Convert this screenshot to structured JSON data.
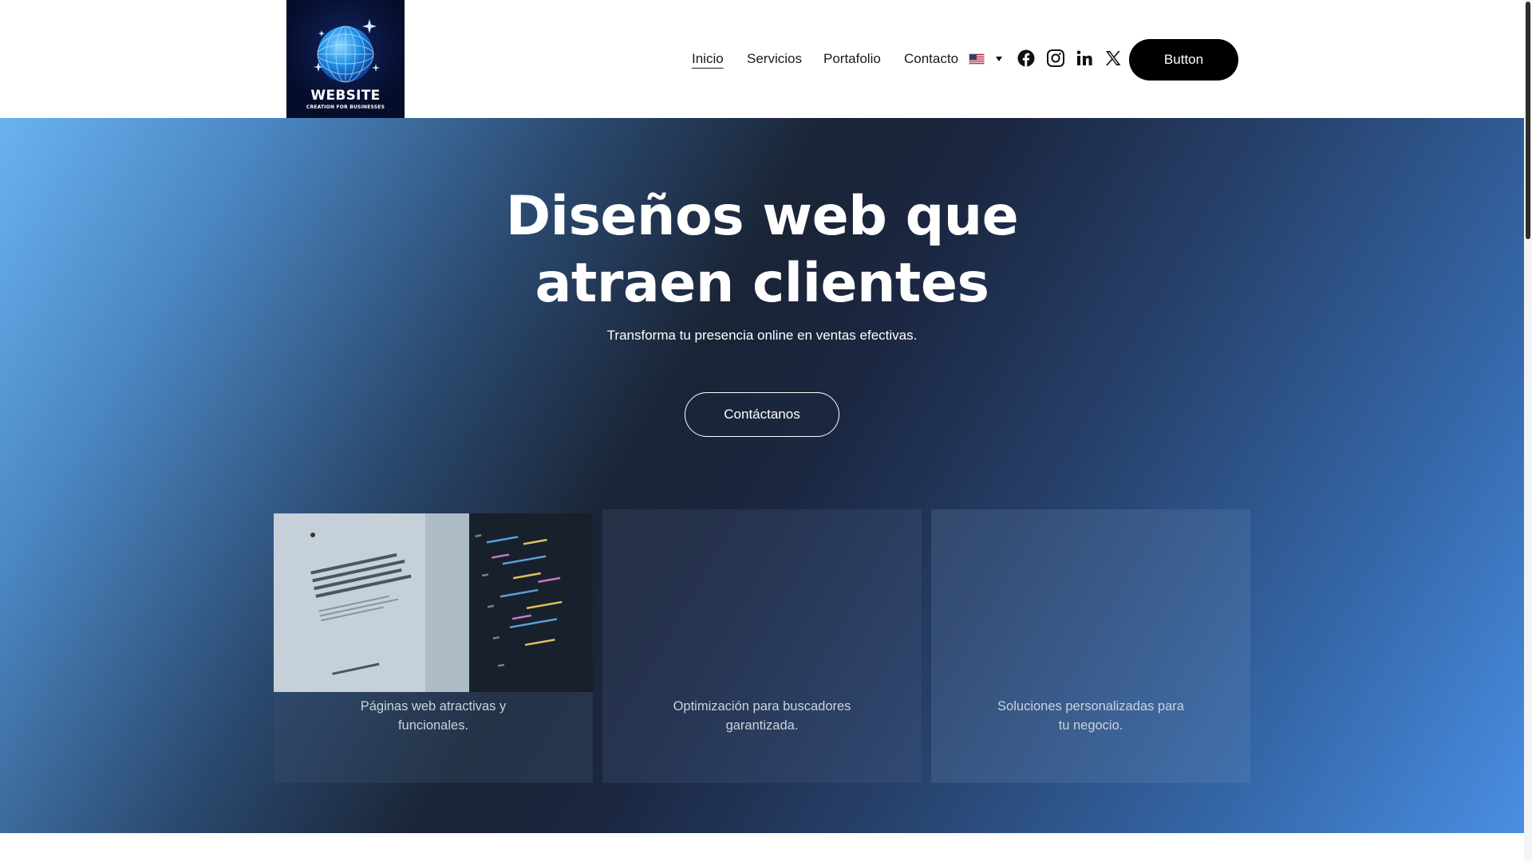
{
  "logo": {
    "title": "WEBSITE",
    "subtitle": "CREATION FOR BUSINESSES",
    "icon": "globe-icon"
  },
  "nav": {
    "items": [
      {
        "label": "Inicio",
        "active": true
      },
      {
        "label": "Servicios",
        "active": false
      },
      {
        "label": "Portafolio",
        "active": false
      },
      {
        "label": "Contacto",
        "active": false
      }
    ],
    "language_flag": "us-flag-icon"
  },
  "social": [
    "facebook-icon",
    "instagram-icon",
    "linkedin-icon",
    "x-icon"
  ],
  "header_button": "Button",
  "hero": {
    "title_line1": "Diseños web que",
    "title_line2": "atraen clientes",
    "subtitle": "Transforma tu presencia online en ventas efectivas.",
    "cta": "Contáctanos"
  },
  "cards": [
    {
      "line1": "Páginas web atractivas y",
      "line2": "funcionales."
    },
    {
      "line1": "Optimización para buscadores",
      "line2": "garantizada."
    },
    {
      "line1": "Soluciones personalizadas para",
      "line2": "tu negocio."
    }
  ],
  "colors": {
    "header_bg": "#ffffff",
    "button_bg": "#000000",
    "hero_gradient_start": "#69b3f0",
    "hero_gradient_mid": "#1a2436",
    "hero_gradient_end": "#4a8ee3"
  }
}
